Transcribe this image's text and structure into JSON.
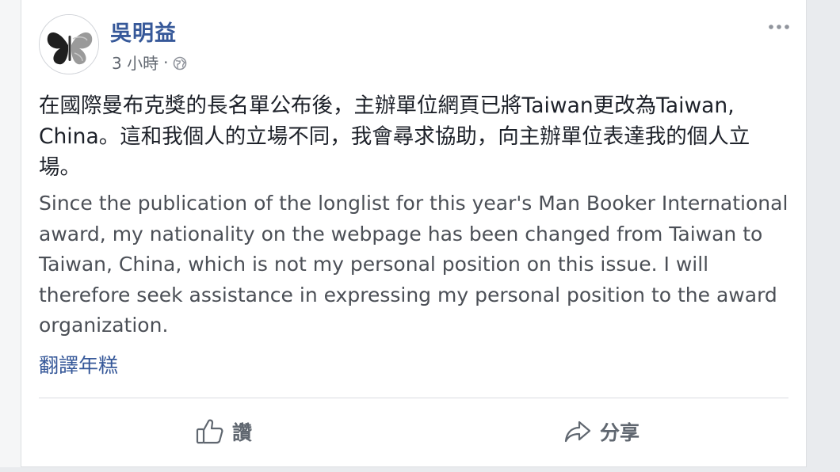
{
  "post": {
    "author": "吳明益",
    "time": "3 小時",
    "separator": "·",
    "privacy_icon": "globe-icon",
    "more_icon": "more-options-icon",
    "text_zh": "在國際曼布克獎的長名單公布後，主辦單位網頁已將Taiwan更改為Taiwan, China。這和我個人的立場不同，我會尋求協助，向主辦單位表達我的個人立場。",
    "text_en": "Since the publication of the longlist for this year's Man Booker International award, my nationality on the webpage has been changed from Taiwan to Taiwan, China, which is not my personal position on this issue. I will therefore seek assistance in expressing my personal position to the award organization.",
    "translate_label": "翻譯年糕"
  },
  "actions": {
    "like_label": "讚",
    "share_label": "分享"
  },
  "colors": {
    "link": "#365899",
    "body_text": "#1d2129",
    "secondary_text": "#616770",
    "background": "#e9ebee"
  }
}
